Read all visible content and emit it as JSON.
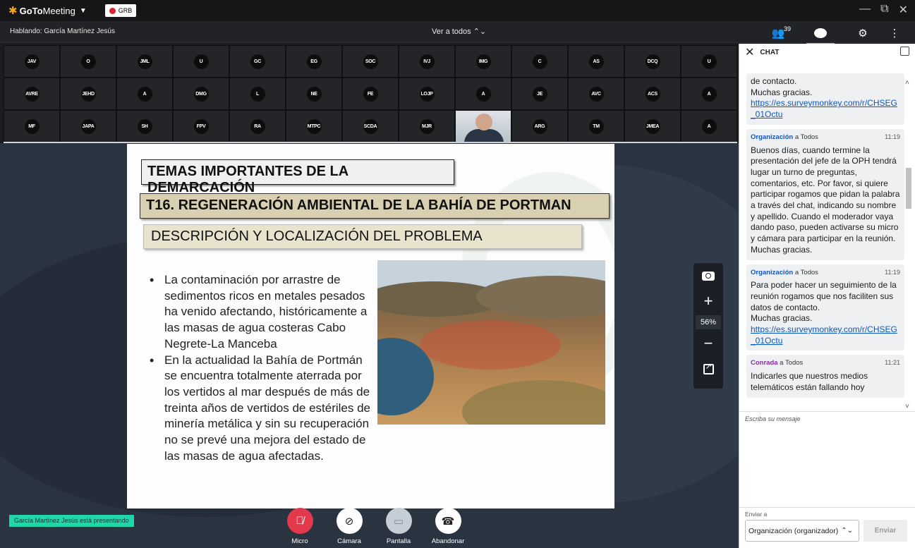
{
  "titlebar": {
    "app_name_bold": "GoTo",
    "app_name_rest": "Meeting",
    "recording_badge": "GRB",
    "window_controls": [
      "—",
      "⧉",
      "✕"
    ]
  },
  "statusbar": {
    "speaking": "Hablando: García Martínez Jesús",
    "view_all": "Ver a todos ⌃⌄",
    "attendee_count": "39"
  },
  "grid": {
    "tiles": [
      "JAV",
      "O",
      "JML",
      "U",
      "GC",
      "EG",
      "SOC",
      "IVJ",
      "IMG",
      "C",
      "AS",
      "DCQ",
      "U",
      "AVRE",
      "JEHD",
      "A",
      "DMG",
      "L",
      "NE",
      "FE",
      "LOJP",
      "A",
      "JE",
      "AVC",
      "ACS",
      "A",
      "MF",
      "JAPA",
      "SH",
      "FPV",
      "RA",
      "MTPC",
      "SCDA",
      "MJR",
      "__VIDEO__",
      "ARG",
      "TM",
      "JMEA",
      "A"
    ]
  },
  "slide": {
    "title1": "TEMAS IMPORTANTES DE LA DEMARCACIÓN",
    "title2": "T16. REGENERACIÓN AMBIENTAL DE LA BAHÍA DE PORTMAN",
    "title3": "DESCRIPCIÓN Y LOCALIZACIÓN DEL PROBLEMA",
    "bullet1": "La  contaminación por arrastre de sedimentos ricos en metales pesados ha venido afectando, históricamente a las masas de agua costeras Cabo Negrete-La Manceba",
    "bullet2": "En la actualidad la Bahía de Portmán se encuentra totalmente aterrada por los vertidos al mar después de más de treinta años de vertidos de estériles de minería metálica y sin su recuperación no se prevé una mejora del estado de las masas de agua afectadas."
  },
  "zoom": {
    "percent": "56%"
  },
  "presenter_badge": "García Martínez Jesús está presentando",
  "controls": {
    "mic": "Micro",
    "camera": "Cámara",
    "screen": "Pantalla",
    "leave": "Abandonar"
  },
  "chat": {
    "title": "CHAT",
    "messages": [
      {
        "body_pre": "de contacto.\nMuchas gracias.",
        "link": "https://es.surveymonkey.com/r/CHSEG_01Octu"
      },
      {
        "from": "Organización",
        "to": " a Todos",
        "time": "11:19",
        "body": "Buenos días, cuando termine la presentación del jefe de la OPH tendrá lugar un turno de preguntas, comentarios, etc. Por favor, si quiere participar rogamos que pidan la palabra a través del chat, indicando su nombre y apellido. Cuando el moderador vaya dando paso, pueden activarse su micro y cámara para participar en la reunión. Muchas gracias."
      },
      {
        "from": "Organización",
        "to": " a Todos",
        "time": "11:19",
        "body": "Para poder hacer un seguimiento de la reunión rogamos que nos faciliten sus datos de contacto.\nMuchas gracias.",
        "link": "https://es.surveymonkey.com/r/CHSEG_01Octu"
      },
      {
        "from": "Conrada",
        "to": " a Todos",
        "time": "11:21",
        "body": "Indicarles que nuestros medios telemáticos están fallando hoy"
      }
    ],
    "compose_placeholder": "Escriba su mensaje",
    "send_to_label": "Enviar a",
    "send_to_value": "Organización (organizador)",
    "send_button": "Enviar"
  }
}
